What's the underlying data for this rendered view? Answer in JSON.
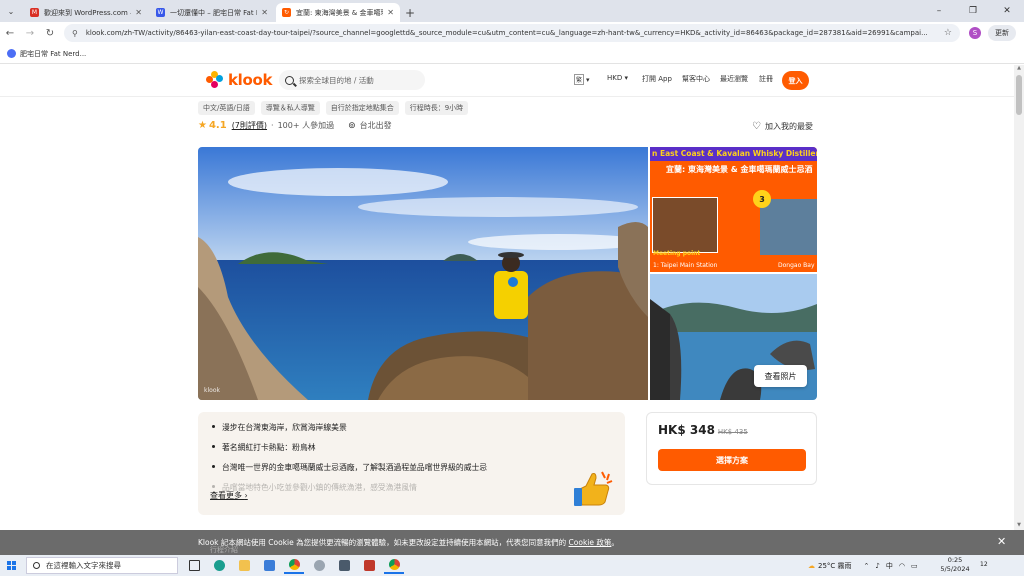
{
  "browser": {
    "tabs": [
      {
        "title": "歡迎來到 WordPress.com – fa",
        "favicon_color": "#d93025",
        "favicon_glyph": "M",
        "active": false
      },
      {
        "title": "一切還懂中 – 肥宅日常 Fat Ner",
        "favicon_color": "#3858e9",
        "favicon_glyph": "W",
        "active": false
      },
      {
        "title": "宜蘭: 東海灣美景 & 金車噶瑪蘭",
        "favicon_color": "#ff5b00",
        "favicon_glyph": "↻",
        "active": true
      }
    ],
    "new_tab_glyph": "+",
    "window_controls": [
      "–",
      "❐",
      "✕"
    ],
    "url": "klook.com/zh-TW/activity/86463-yilan-east-coast-day-tour-taipei/?source_channel=googlettd&_source_module=cu&utm_content=cu&_language=zh-hant-tw&_currency=HKD&_activity_id=86463&package_id=287381&aid=26991&campai...",
    "profile_initial": "S",
    "update_label": "更新",
    "bookmarks": [
      {
        "label": "肥宅日常 Fat Nerd..."
      }
    ]
  },
  "site": {
    "brand": "klook",
    "brand_color": "#ff5b00",
    "search_placeholder": "探索全球目的地 / 活動",
    "nav": {
      "lang_box": "繁",
      "currency": "HKD",
      "open_app": "打開 App",
      "help": "幫客中心",
      "recent": "最近瀏覽",
      "signup": "註冊",
      "login": "登入"
    }
  },
  "activity": {
    "tags": [
      "中文/英語/日語",
      "導覽＆私人導覽",
      "自行於指定地點集合",
      "行程時長：9小時"
    ],
    "rating": "4.1",
    "reviews": "(7則評價)",
    "booked": "100+ 人參加過",
    "departure": "台北出發",
    "wishlist": "加入我的最愛"
  },
  "gallery": {
    "banner_en": "n East Coast & Kavalan Whisky Distillery",
    "banner_zh": "宜蘭: 東海灣美景 & 金車噶瑪蘭威士忌酒",
    "step_number": "3",
    "meeting_point": "Meeting point",
    "caption_left": "1: Taipei Main Station",
    "caption_right": "Dongao Bay",
    "view_photos": "查看照片",
    "watermark": "klook"
  },
  "highlights": {
    "items": [
      "漫步在台灣東海岸，欣賞海岸線美景",
      "著名網紅打卡熱點：粉鳥林",
      "台灣唯一世界的金車噶瑪蘭威士忌酒廠，了解製酒過程並品嚐世界級的威士忌",
      "品嚐當地特色小吃並參觀小鎮的傳統漁港，感受漁港風情"
    ],
    "see_more": "查看更多"
  },
  "price_card": {
    "price": "HK$ 348",
    "original_price": "HK$ 435",
    "cta": "選擇方案"
  },
  "cookie": {
    "text_pre": "Klook 記本網站使用 Cookie 為您提供更流暢的瀏覽體驗，如未更改設定並持續使用本網站，代表您同意我們的",
    "link": "Cookie 政策",
    "text_post": "。",
    "behind_text": "行程介紹",
    "close": "✕"
  },
  "taskbar": {
    "search_placeholder": "在這裡輸入文字來搜尋",
    "weather": "25°C 霧雨",
    "ime": "中",
    "time": "0:25",
    "date": "5/5/2024",
    "notif_count": "12"
  }
}
